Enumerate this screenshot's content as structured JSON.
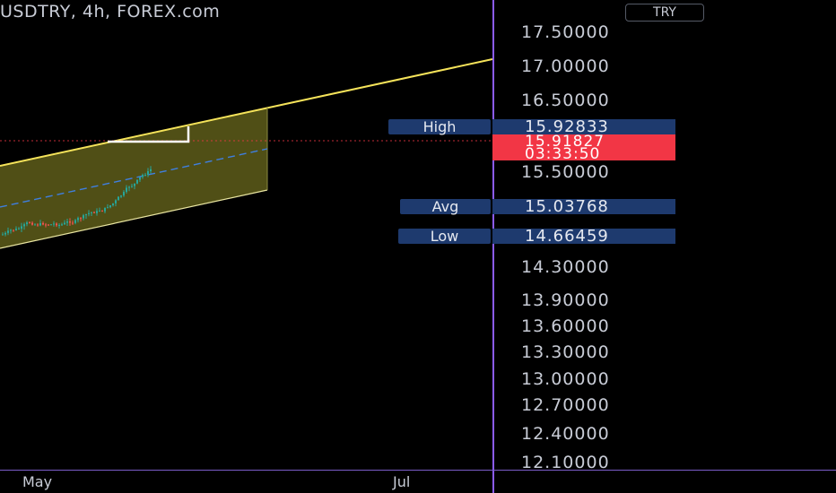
{
  "header": {
    "title": "USDTRY, 4h, FOREX.com",
    "currency": "TRY"
  },
  "chart_data": {
    "type": "line",
    "title": "USDTRY, 4h, FOREX.com",
    "x_tick_labels": [
      "May",
      "Jul"
    ],
    "y_tick_labels": [
      "17.50000",
      "17.00000",
      "16.50000",
      "15.50000",
      "14.30000",
      "13.90000",
      "13.60000",
      "13.30000",
      "13.00000",
      "12.70000",
      "12.40000",
      "12.10000"
    ],
    "y_scale": "irregular (as printed)",
    "grid": false,
    "colors": {
      "channel_line": "#f5e35a",
      "channel_fill": "#6b6a1e",
      "midline": "#3f7fe0",
      "up": "#26a69a",
      "down": "#ef5350",
      "current": "#f23645",
      "scale_divider": "#8b5cf6",
      "label_bg": "#1e3a6e"
    },
    "annotations": [
      {
        "label": "High",
        "value": "15.92833"
      },
      {
        "label": "Avg",
        "value": "15.03768"
      },
      {
        "label": "Low",
        "value": "14.66459"
      }
    ],
    "current_price": {
      "value": "15.91827",
      "countdown": "03:33:50"
    }
  }
}
